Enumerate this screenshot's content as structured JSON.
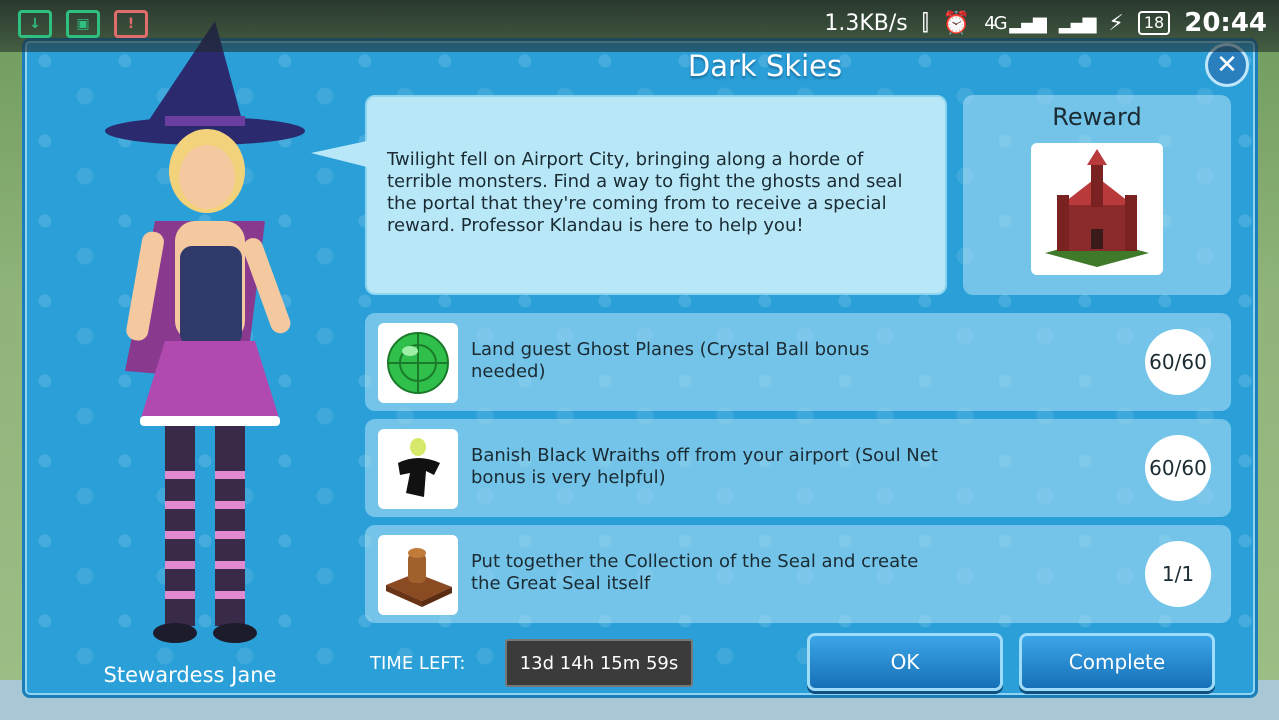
{
  "status_bar": {
    "net_speed": "1.3KB/s",
    "network_type": "4G",
    "battery": "18",
    "time": "20:44"
  },
  "dialog": {
    "title": "Dark Skies",
    "character_name": "Stewardess Jane",
    "description": "Twilight fell on Airport City, bringing along a horde of terrible monsters. Find a way to fight the ghosts and seal the portal that they're coming from to receive a special reward. Professor Klandau is here to help you!",
    "reward_label": "Reward",
    "tasks": [
      {
        "text": "Land guest Ghost Planes (Crystal Ball bonus needed)",
        "progress": "60/60",
        "icon": "crystal-ball-icon"
      },
      {
        "text": "Banish Black Wraiths off from your airport (Soul Net bonus is very helpful)",
        "progress": "60/60",
        "icon": "black-wraith-icon"
      },
      {
        "text": "Put together the Collection of the Seal and create the Great Seal itself",
        "progress": "1/1",
        "icon": "great-seal-icon"
      }
    ],
    "time_left_label": "TIME LEFT:",
    "time_left_value": "13d 14h 15m 59s",
    "ok_label": "OK",
    "complete_label": "Complete"
  }
}
